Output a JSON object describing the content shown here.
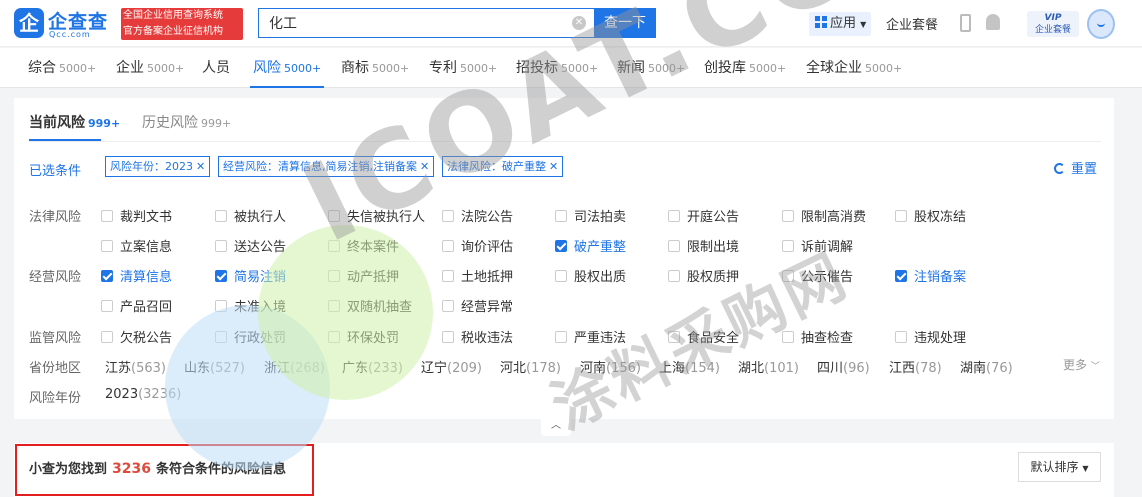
{
  "header": {
    "logo_mark": "企",
    "logo_name": "企查查",
    "logo_sub": "Qcc.com",
    "slogan_line1": "全国企业信用查询系统",
    "slogan_line2": "官方备案企业征信机构",
    "search_value": "化工",
    "search_button": "查一下",
    "app_label": "应用",
    "suite_label": "企业套餐",
    "vip_line1": "VIP",
    "vip_line2": "企业套餐"
  },
  "tabs": [
    {
      "label": "综合",
      "count": "5000+",
      "active": false
    },
    {
      "label": "企业",
      "count": "5000+",
      "active": false
    },
    {
      "label": "人员",
      "count": "",
      "active": false
    },
    {
      "label": "风险",
      "count": "5000+",
      "active": true
    },
    {
      "label": "商标",
      "count": "5000+",
      "active": false
    },
    {
      "label": "专利",
      "count": "5000+",
      "active": false
    },
    {
      "label": "招投标",
      "count": "5000+",
      "active": false
    },
    {
      "label": "新闻",
      "count": "5000+",
      "active": false
    },
    {
      "label": "创投库",
      "count": "5000+",
      "active": false
    },
    {
      "label": "全球企业",
      "count": "5000+",
      "active": false
    }
  ],
  "risk_tabs": {
    "current_label": "当前风险",
    "current_count": "999+",
    "history_label": "历史风险",
    "history_count": "999+"
  },
  "selected": {
    "label": "已选条件",
    "chips": [
      "风险年份：2023",
      "经营风险：清算信息,简易注销,注销备案",
      "法律风险：破产重整"
    ],
    "reset_label": "重置"
  },
  "filters": {
    "legal_label": "法律风险",
    "legal_row1": [
      "裁判文书",
      "被执行人",
      "失信被执行人",
      "法院公告",
      "司法拍卖",
      "开庭公告",
      "限制高消费",
      "股权冻结"
    ],
    "legal_row2": [
      "立案信息",
      "送达公告",
      "终本案件",
      "询价评估",
      "破产重整",
      "限制出境",
      "诉前调解"
    ],
    "legal_row2_checked": "破产重整",
    "business_label": "经营风险",
    "business_row1": [
      "清算信息",
      "简易注销",
      "动产抵押",
      "土地抵押",
      "股权出质",
      "股权质押",
      "公示催告",
      "注销备案"
    ],
    "business_row2": [
      "产品召回",
      "未准入境",
      "双随机抽查",
      "经营异常"
    ],
    "business_checked": [
      "清算信息",
      "简易注销",
      "注销备案"
    ],
    "regulatory_label": "监管风险",
    "regulatory_row": [
      "欠税公告",
      "行政处罚",
      "环保处罚",
      "税收违法",
      "严重违法",
      "食品安全",
      "抽查检查",
      "违规处理"
    ],
    "region_label": "省份地区",
    "regions": [
      {
        "name": "江苏",
        "count": "(563)"
      },
      {
        "name": "山东",
        "count": "(527)"
      },
      {
        "name": "浙江",
        "count": "(268)"
      },
      {
        "name": "广东",
        "count": "(233)"
      },
      {
        "name": "辽宁",
        "count": "(209)"
      },
      {
        "name": "河北",
        "count": "(178)"
      },
      {
        "name": "河南",
        "count": "(156)"
      },
      {
        "name": "上海",
        "count": "(154)"
      },
      {
        "name": "湖北",
        "count": "(101)"
      },
      {
        "name": "四川",
        "count": "(96)"
      },
      {
        "name": "江西",
        "count": "(78)"
      },
      {
        "name": "湖南",
        "count": "(76)"
      }
    ],
    "more_label": "更多",
    "year_label": "风险年份",
    "year_value": "2023",
    "year_count": "(3236)"
  },
  "results": {
    "prefix": "小查为您找到",
    "count": "3236",
    "suffix": "条符合条件的风险信息",
    "sort_label": "默认排序"
  },
  "watermark": {
    "text": "ICOAT.CC",
    "cn_text": "涂料采购网"
  }
}
